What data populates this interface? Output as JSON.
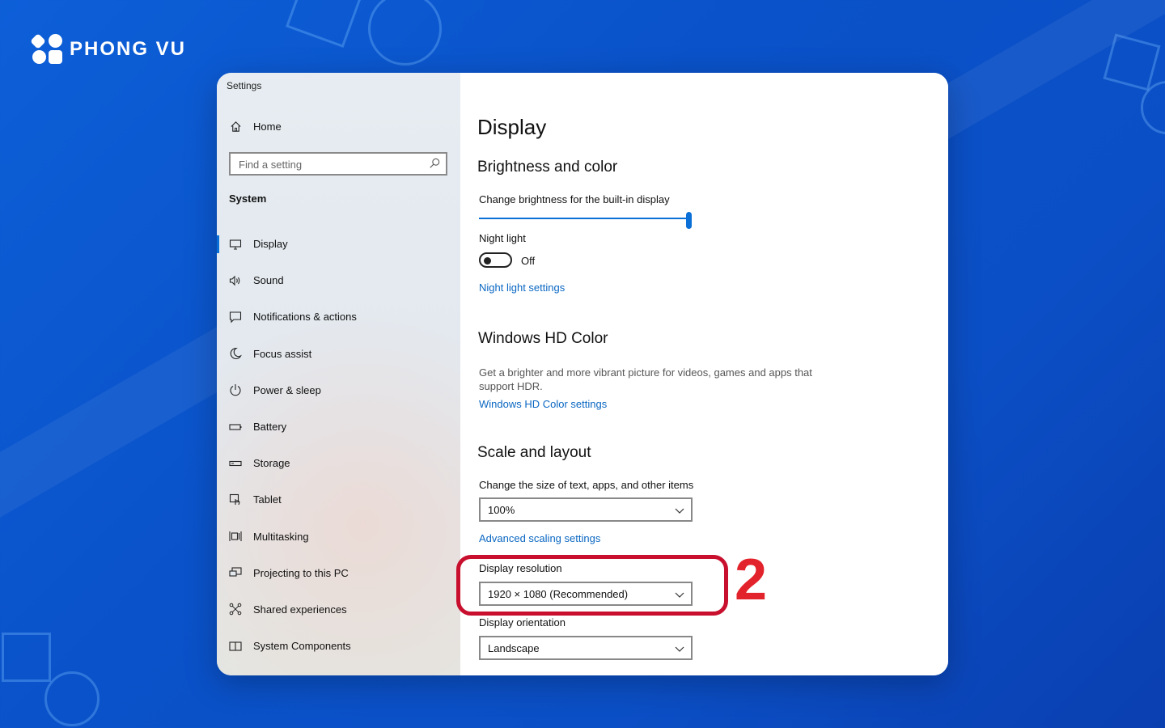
{
  "brand": {
    "name": "PHONG VU"
  },
  "window": {
    "title": "Settings"
  },
  "sidebar": {
    "home_label": "Home",
    "search_placeholder": "Find a setting",
    "section_label": "System",
    "items": [
      {
        "label": "Display",
        "icon": "monitor-icon",
        "active": true
      },
      {
        "label": "Sound",
        "icon": "speaker-icon"
      },
      {
        "label": "Notifications & actions",
        "icon": "notification-icon"
      },
      {
        "label": "Focus assist",
        "icon": "moon-icon"
      },
      {
        "label": "Power & sleep",
        "icon": "power-icon"
      },
      {
        "label": "Battery",
        "icon": "battery-icon"
      },
      {
        "label": "Storage",
        "icon": "storage-icon"
      },
      {
        "label": "Tablet",
        "icon": "tablet-icon"
      },
      {
        "label": "Multitasking",
        "icon": "multitasking-icon"
      },
      {
        "label": "Projecting to this PC",
        "icon": "projecting-icon"
      },
      {
        "label": "Shared experiences",
        "icon": "shared-icon"
      },
      {
        "label": "System Components",
        "icon": "components-icon"
      }
    ]
  },
  "main": {
    "title": "Display",
    "brightness": {
      "heading": "Brightness and color",
      "label": "Change brightness for the built-in display",
      "level": 1.0
    },
    "night_light": {
      "label": "Night light",
      "state": "Off",
      "settings_link": "Night light settings"
    },
    "hdr": {
      "heading": "Windows HD Color",
      "description": "Get a brighter and more vibrant picture for videos, games and apps that support HDR.",
      "settings_link": "Windows HD Color settings"
    },
    "scale": {
      "heading": "Scale and layout",
      "size_label": "Change the size of text, apps, and other items",
      "size_value": "100%",
      "advanced_link": "Advanced scaling settings",
      "resolution_label": "Display resolution",
      "resolution_value": "1920 × 1080 (Recommended)",
      "orientation_label": "Display orientation",
      "orientation_value": "Landscape"
    }
  },
  "annotation": {
    "step": "2",
    "color": "#e3232b"
  },
  "colors": {
    "accent": "#0a6fd6",
    "link": "#0a67c2",
    "highlight": "#c8102e"
  }
}
